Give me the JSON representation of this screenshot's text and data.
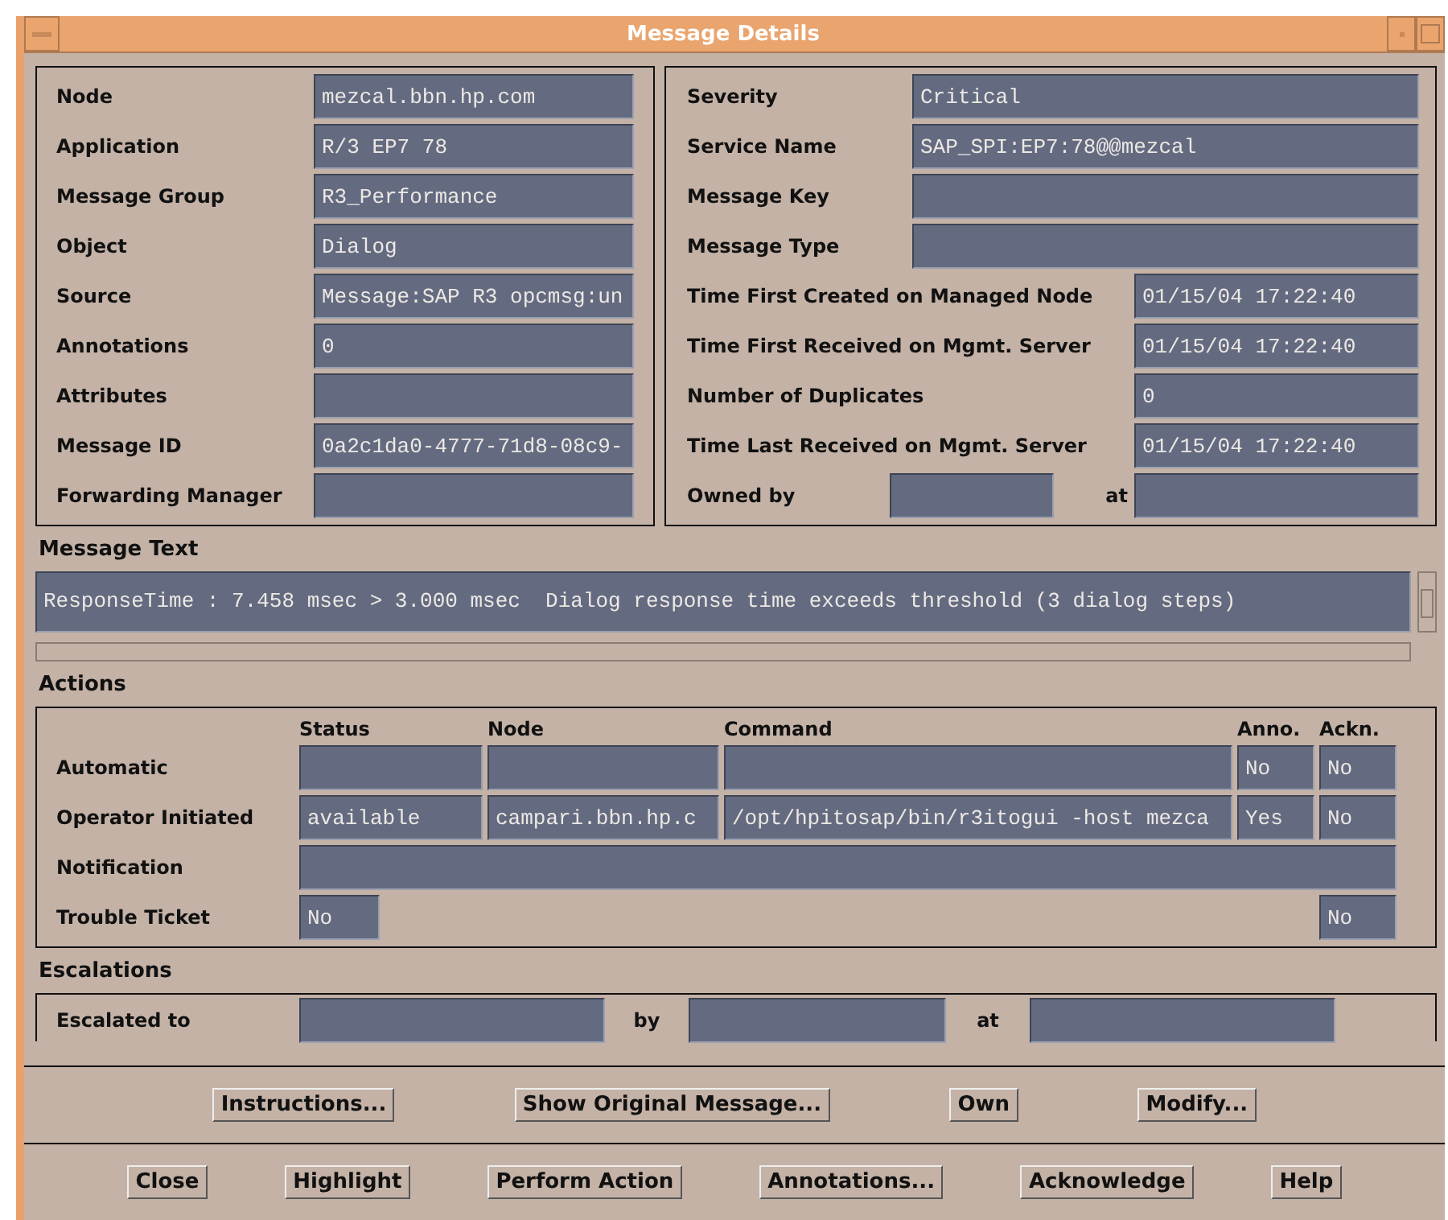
{
  "window": {
    "title": "Message Details"
  },
  "details_left": [
    {
      "label": "Node",
      "value": "mezcal.bbn.hp.com"
    },
    {
      "label": "Application",
      "value": "R/3 EP7 78"
    },
    {
      "label": "Message Group",
      "value": "R3_Performance"
    },
    {
      "label": "Object",
      "value": "Dialog"
    },
    {
      "label": "Source",
      "value": "Message:SAP R3 opcmsg:un"
    },
    {
      "label": "Annotations",
      "value": "0"
    },
    {
      "label": "Attributes"
    },
    {
      "label": "Message ID",
      "value": "0a2c1da0-4777-71d8-08c9-"
    },
    {
      "label": "Forwarding Manager"
    }
  ],
  "details_right": [
    {
      "kind": "wide",
      "label": "Severity",
      "value": "Critical"
    },
    {
      "kind": "wide",
      "label": "Service Name",
      "value": "SAP_SPI:EP7:78@@mezcal"
    },
    {
      "kind": "wide",
      "label": "Message Key"
    },
    {
      "kind": "wide",
      "label": "Message Type"
    },
    {
      "kind": "narrow",
      "label": "Time First Created on Managed Node",
      "value": "01/15/04 17:22:40"
    },
    {
      "kind": "narrow",
      "label": "Time First Received on Mgmt. Server",
      "value": "01/15/04 17:22:40"
    },
    {
      "kind": "narrow",
      "label": "Number of Duplicates",
      "value": "0"
    },
    {
      "kind": "narrow",
      "label": "Time Last Received on Mgmt. Server",
      "value": "01/15/04 17:22:40"
    },
    {
      "kind": "owner",
      "label": "Owned by",
      "at_label": "at"
    }
  ],
  "message_text": {
    "label": "Message Text",
    "value": "ResponseTime : 7.458 msec > 3.000 msec  Dialog response time exceeds threshold (3 dialog steps)"
  },
  "actions": {
    "label": "Actions",
    "columns": [
      "Status",
      "Node",
      "Command",
      "Anno.",
      "Ackn."
    ],
    "rows": [
      {
        "kind": "full",
        "label": "Automatic",
        "anno": "No",
        "ackn": "No"
      },
      {
        "kind": "full",
        "label": "Operator Initiated",
        "status": "available",
        "node": "campari.bbn.hp.c",
        "command": "/opt/hpitosap/bin/r3itogui -host mezca",
        "anno": "Yes",
        "ackn": "No"
      },
      {
        "kind": "span",
        "label": "Notification"
      },
      {
        "kind": "ticket",
        "label": "Trouble Ticket",
        "status": "No",
        "ackn": "No"
      }
    ]
  },
  "escalations": {
    "label": "Escalations",
    "to_label": "Escalated to",
    "by_label": "by",
    "at_label": "at"
  },
  "buttons_row1": [
    "Instructions...",
    "Show Original Message...",
    "Own",
    "Modify..."
  ],
  "buttons_row2": [
    "Close",
    "Highlight",
    "Perform Action",
    "Annotations...",
    "Acknowledge",
    "Help"
  ]
}
